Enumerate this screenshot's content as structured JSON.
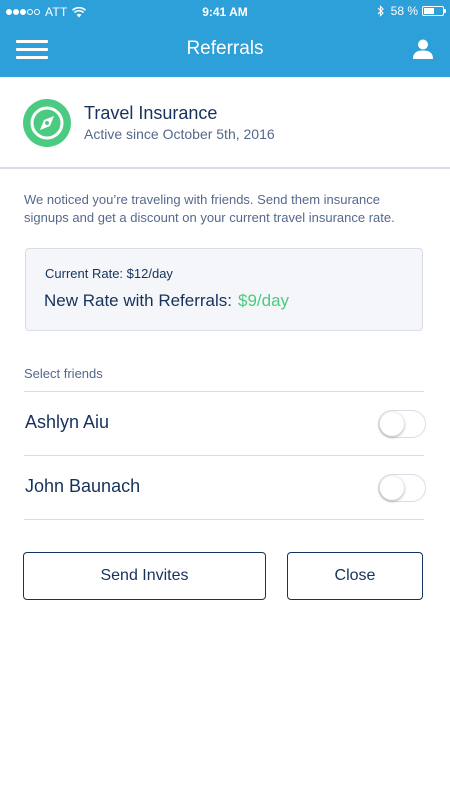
{
  "status_bar": {
    "carrier": "ATT",
    "time": "9:41 AM",
    "battery_pct": "58 %",
    "signal_bars_filled": 3,
    "signal_bars_total": 5
  },
  "nav": {
    "title": "Referrals",
    "menu_icon": "hamburger-menu-icon",
    "user_icon": "user-icon"
  },
  "policy": {
    "icon": "compass-icon",
    "title": "Travel Insurance",
    "subtitle": "Active since October 5th, 2016"
  },
  "notice": "We noticed you’re traveling with friends. Send them insurance signups and get a discount on your current travel insurance rate.",
  "rates": {
    "current_label": "Current Rate:",
    "current_value": "$12/day",
    "new_label": "New Rate with Referrals:",
    "new_value": "$9/day"
  },
  "friends": {
    "label": "Select friends",
    "items": [
      {
        "name": "Ashlyn Aiu",
        "selected": false
      },
      {
        "name": "John Baunach",
        "selected": false
      }
    ]
  },
  "buttons": {
    "send": "Send Invites",
    "close": "Close"
  },
  "colors": {
    "header_blue": "#2d9fd9",
    "accent_green": "#4bca81",
    "text_navy": "#16325c",
    "text_muted": "#54698d"
  }
}
